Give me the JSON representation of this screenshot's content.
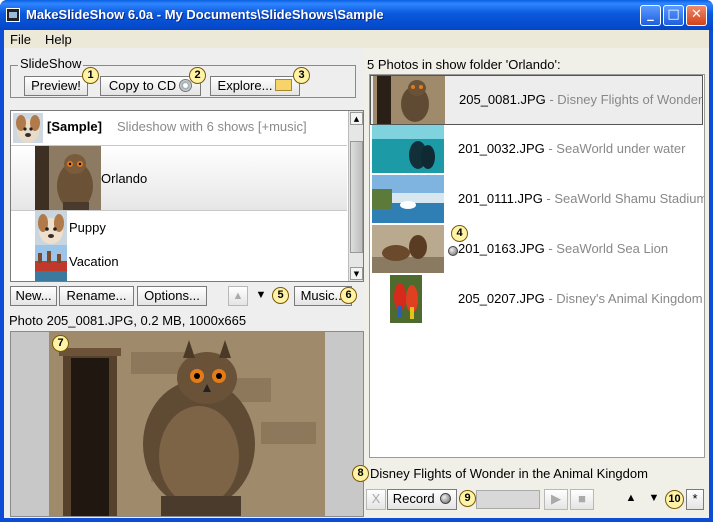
{
  "window": {
    "title": "MakeSlideShow 6.0a - My Documents\\SlideShows\\Sample",
    "min_label": "_",
    "max_label": "□",
    "close_label": "✕"
  },
  "menu": {
    "file": "File",
    "help": "Help"
  },
  "slideshow_group": {
    "legend": "SlideShow",
    "preview_label": "Preview!",
    "copy_cd_label": "Copy to CD",
    "explore_label": "Explore..."
  },
  "callouts": [
    "1",
    "2",
    "3",
    "4",
    "5",
    "6",
    "7",
    "8",
    "9",
    "10"
  ],
  "show_list": {
    "header_name": "[Sample]",
    "header_desc": "Slideshow with 6 shows  [+music]",
    "items": [
      {
        "label": "Orlando"
      },
      {
        "label": "Puppy"
      },
      {
        "label": "Vacation"
      }
    ]
  },
  "show_toolbar": {
    "new_label": "New...",
    "rename_label": "Rename...",
    "options_label": "Options...",
    "up_glyph": "▲",
    "down_glyph": "▼",
    "music_label": "Music..."
  },
  "photo_info": "Photo 205_0081.JPG, 0.2 MB, 1000x665",
  "photos": {
    "header": "5 Photos in show folder 'Orlando':",
    "items": [
      {
        "file": "205_0081.JPG",
        "desc": " - Disney Flights of Wonder"
      },
      {
        "file": "201_0032.JPG",
        "desc": " - SeaWorld under water"
      },
      {
        "file": "201_0111.JPG",
        "desc": " - SeaWorld Shamu Stadium"
      },
      {
        "file": "201_0163.JPG",
        "desc": " - SeaWorld Sea Lion"
      },
      {
        "file": "205_0207.JPG",
        "desc": " - Disney's Animal Kingdom"
      }
    ]
  },
  "caption": "Disney Flights of Wonder in the Animal Kingdom",
  "bottom_toolbar": {
    "delete_label": "X",
    "record_label": "Record",
    "play_glyph": "▶",
    "stop_glyph": "■",
    "up_glyph": "▲",
    "down_glyph": "▼",
    "star_label": "*"
  }
}
